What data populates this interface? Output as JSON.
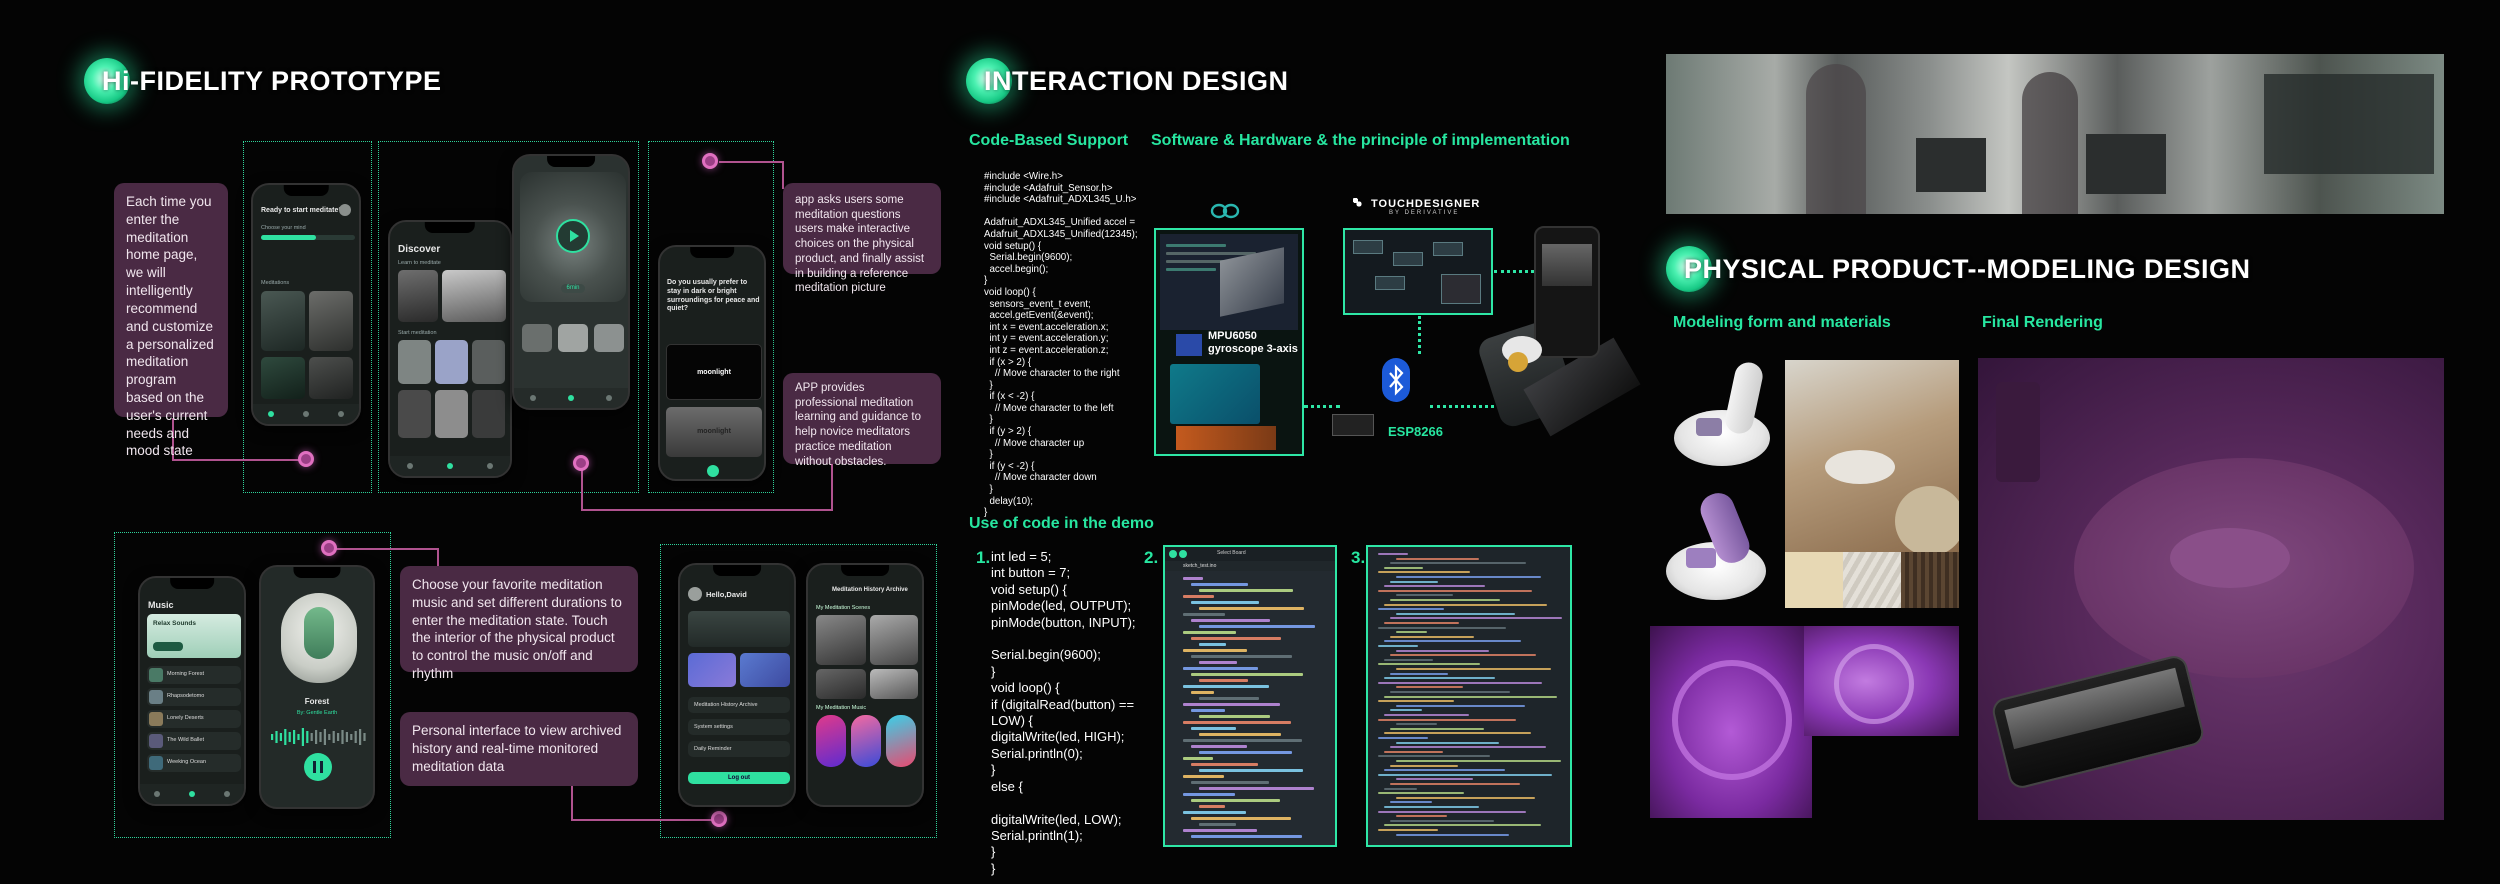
{
  "headings": {
    "prototype": "Hi-FIDELITY PROTOTYPE",
    "interaction": "INTERACTION DESIGN",
    "physical": "PHYSICAL PRODUCT--MODELING DESIGN"
  },
  "labels": {
    "code_support": "Code-Based Support",
    "sw_hw": "Software & Hardware & the principle of implementation",
    "use_code": "Use of code in the demo",
    "modeling_form": "Modeling form and materials",
    "final_rendering": "Final Rendering"
  },
  "callouts": {
    "home": "Each time you enter the meditation home page, we will intelligently recommend and customize a personalized meditation program based on the user's current needs and mood state",
    "questions": "app asks users some meditation questions users make interactive choices on the physical product, and finally assist in building a reference meditation picture",
    "guidance": "APP provides professional meditation learning and guidance to help novice meditators practice meditation without obstacles.",
    "music": "Choose your favorite meditation music and set different durations to enter the meditation state. Touch the interior of the physical product to control the music on/off and rhythm",
    "personal": "Personal interface to view archived history and real-time monitored meditation data"
  },
  "phones": {
    "p1": {
      "title": "Ready to start meditate?",
      "sub1": "Choose your mind",
      "sub2": "Meditations"
    },
    "p2": {
      "title": "Discover",
      "sub1": "Learn to meditate",
      "sub2": "Start meditation"
    },
    "p3": {
      "tag": "6min"
    },
    "p4": {
      "title": "Do you usually prefer to stay in dark or bright surroundings for peace and quiet?",
      "opt1": "moonlight",
      "opt2": "moonlight"
    },
    "p5": {
      "title": "Music",
      "card": "Relax Sounds",
      "items": [
        "Morning Forest",
        "Rhapsodetomo",
        "Lonely Deserts",
        "The Wild Ballet",
        "Weeking Ocean"
      ]
    },
    "p6": {
      "title": "Forest",
      "sub": "By: Gentle Earth"
    },
    "p7": {
      "title": "Hello,David",
      "items": [
        "Meditation History Archive",
        "System settings",
        "Daily Reminder"
      ],
      "logout": "Log out"
    },
    "p8": {
      "title": "Meditation History Archive",
      "sec1": "My Meditation Scenes",
      "sec2": "My Meditation Music"
    }
  },
  "code_top": "#include <Wire.h>\n#include <Adafruit_Sensor.h>\n#include <Adafruit_ADXL345_U.h>\n\nAdafruit_ADXL345_Unified accel =\nAdafruit_ADXL345_Unified(12345);\nvoid setup() {\n  Serial.begin(9600);\n  accel.begin();\n}\nvoid loop() {\n  sensors_event_t event;\n  accel.getEvent(&event);\n  int x = event.acceleration.x;\n  int y = event.acceleration.y;\n  int z = event.acceleration.z;\n  if (x > 2) {\n    // Move character to the right\n  }\n  if (x < -2) {\n    // Move character to the left\n  }\n  if (y > 2) {\n    // Move character up\n  }\n  if (y < -2) {\n    // Move character down\n  }\n  delay(10);\n}",
  "code_demo": "int led = 5;\nint button = 7;\nvoid setup() {\npinMode(led, OUTPUT);\npinMode(button, INPUT);\n\nSerial.begin(9600);\n}\nvoid loop() {\nif (digitalRead(button) ==\nLOW) {\ndigitalWrite(led, HIGH);\nSerial.println(0);\n}\nelse {\n\ndigitalWrite(led, LOW);\nSerial.println(1);\n}\n}",
  "demo_numbers": [
    "1.",
    "2.",
    "3."
  ],
  "hardware": {
    "sensor": "MPU6050\ngyroscope 3-axis",
    "wifi": "ESP8266",
    "td_brand": "TOUCHDESIGNER",
    "td_sub": "BY DERIVATIVE",
    "arduino_label": "ARDUINO"
  },
  "editor2": {
    "tab1": "Select Board",
    "tab2": "sketch_test.ino"
  },
  "arrow": "↓",
  "colors": {
    "accent": "#27e6a0",
    "callout": "#4a2a44",
    "connector": "#b0538f",
    "render": "#5a2a5c"
  }
}
